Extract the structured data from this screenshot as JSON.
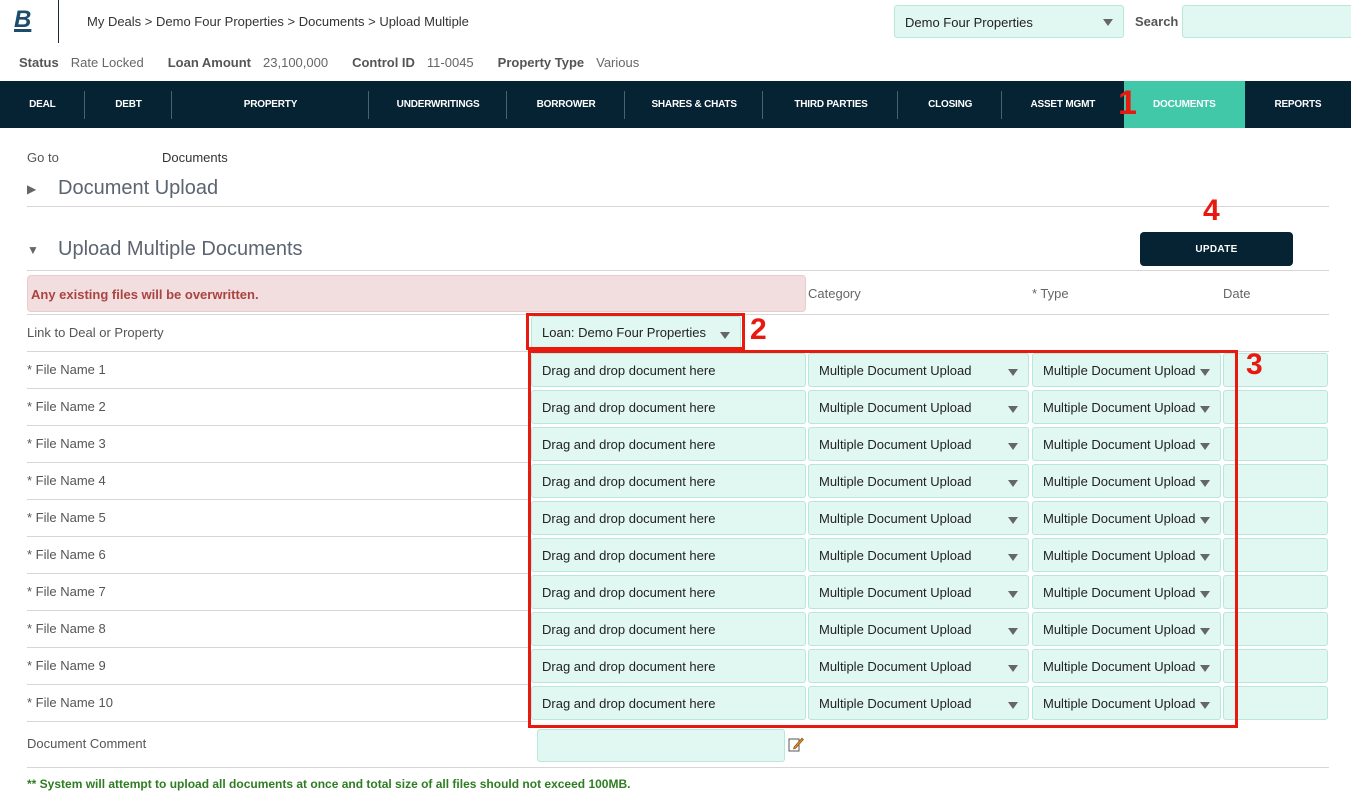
{
  "app": {
    "logo_text": "B"
  },
  "breadcrumb": [
    "My Deals",
    "Demo Four Properties",
    "Documents",
    "Upload Multiple"
  ],
  "breadcrumb_sep": " > ",
  "header": {
    "deal_select_value": "Demo Four Properties",
    "search_label": "Search",
    "search_value": ""
  },
  "status": {
    "status_label": "Status",
    "status_value": "Rate Locked",
    "loan_label": "Loan Amount",
    "loan_value": "23,100,000",
    "control_label": "Control ID",
    "control_value": "11-0045",
    "ptype_label": "Property Type",
    "ptype_value": "Various"
  },
  "nav": {
    "items": [
      {
        "label": "DEAL"
      },
      {
        "label": "DEBT"
      },
      {
        "label": "PROPERTY"
      },
      {
        "label": "UNDERWRITINGS"
      },
      {
        "label": "BORROWER"
      },
      {
        "label": "SHARES & CHATS"
      },
      {
        "label": "THIRD PARTIES"
      },
      {
        "label": "CLOSING"
      },
      {
        "label": "ASSET MGMT"
      },
      {
        "label": "DOCUMENTS",
        "active": true
      },
      {
        "label": "REPORTS"
      }
    ]
  },
  "annotations": {
    "a1": "1",
    "a2": "2",
    "a3": "3",
    "a4": "4"
  },
  "goto": {
    "label": "Go to",
    "value": "Documents"
  },
  "sections": {
    "document_upload": "Document Upload",
    "upload_multiple": "Upload Multiple Documents"
  },
  "update_button": "UPDATE",
  "warning": "Any existing files will be overwritten.",
  "columns": {
    "category": "Category",
    "type": "* Type",
    "date": "Date"
  },
  "link": {
    "label": "Link to Deal or Property",
    "value": "Loan: Demo Four Properties"
  },
  "files": [
    {
      "label": "* File Name 1",
      "drop": "Drag and drop document here",
      "category": "Multiple Document Upload",
      "type": "Multiple Document Upload",
      "date": ""
    },
    {
      "label": "* File Name 2",
      "drop": "Drag and drop document here",
      "category": "Multiple Document Upload",
      "type": "Multiple Document Upload",
      "date": ""
    },
    {
      "label": "* File Name 3",
      "drop": "Drag and drop document here",
      "category": "Multiple Document Upload",
      "type": "Multiple Document Upload",
      "date": ""
    },
    {
      "label": "* File Name 4",
      "drop": "Drag and drop document here",
      "category": "Multiple Document Upload",
      "type": "Multiple Document Upload",
      "date": ""
    },
    {
      "label": "* File Name 5",
      "drop": "Drag and drop document here",
      "category": "Multiple Document Upload",
      "type": "Multiple Document Upload",
      "date": ""
    },
    {
      "label": "* File Name 6",
      "drop": "Drag and drop document here",
      "category": "Multiple Document Upload",
      "type": "Multiple Document Upload",
      "date": ""
    },
    {
      "label": "* File Name 7",
      "drop": "Drag and drop document here",
      "category": "Multiple Document Upload",
      "type": "Multiple Document Upload",
      "date": ""
    },
    {
      "label": "* File Name 8",
      "drop": "Drag and drop document here",
      "category": "Multiple Document Upload",
      "type": "Multiple Document Upload",
      "date": ""
    },
    {
      "label": "* File Name 9",
      "drop": "Drag and drop document here",
      "category": "Multiple Document Upload",
      "type": "Multiple Document Upload",
      "date": ""
    },
    {
      "label": "* File Name 10",
      "drop": "Drag and drop document here",
      "category": "Multiple Document Upload",
      "type": "Multiple Document Upload",
      "date": ""
    }
  ],
  "comment": {
    "label": "Document Comment",
    "value": ""
  },
  "footer_note": "** System will attempt to upload all documents at once and total size of all files should not exceed 100MB."
}
